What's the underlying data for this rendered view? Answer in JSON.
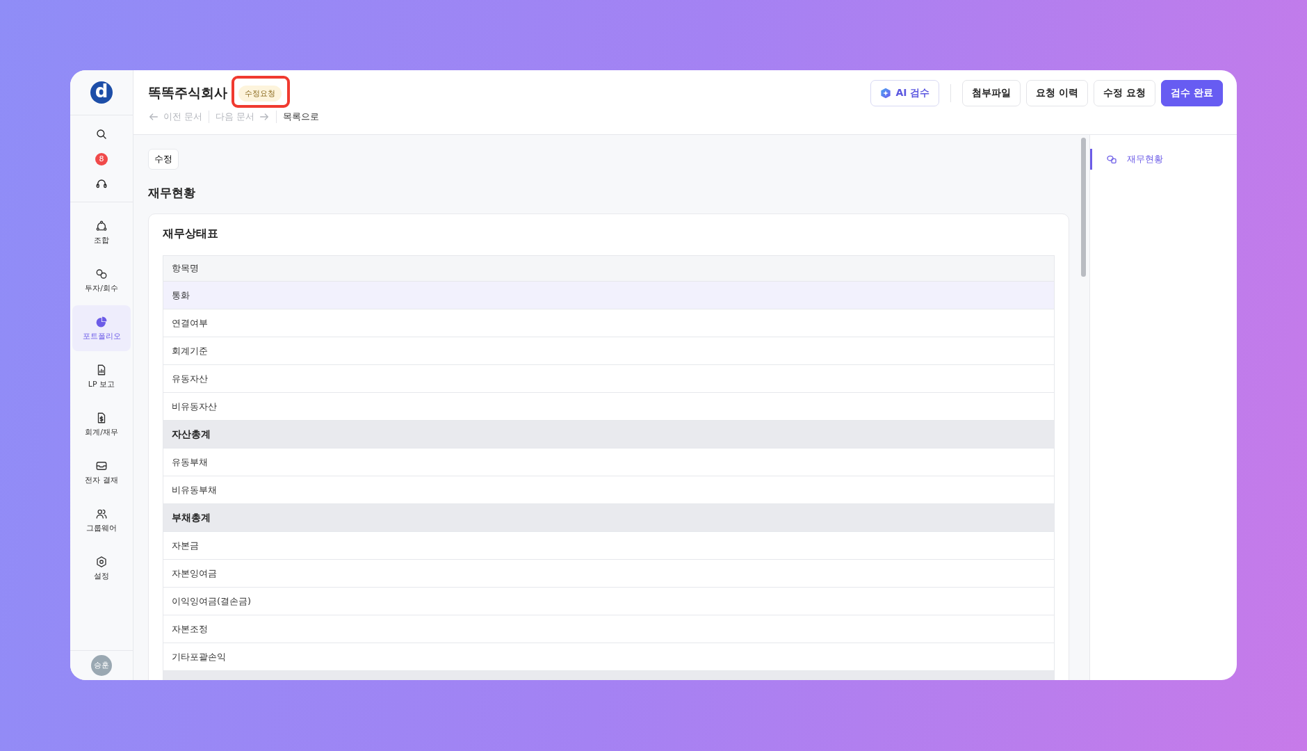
{
  "sidebar": {
    "logo": "d",
    "top_items": [
      {
        "kind": "search"
      },
      {
        "kind": "badge",
        "count": "8"
      },
      {
        "kind": "support"
      }
    ],
    "items": [
      {
        "label": "조합",
        "selected": false
      },
      {
        "label": "투자/회수",
        "selected": false
      },
      {
        "label": "포트폴리오",
        "selected": true
      },
      {
        "label": "LP 보고",
        "selected": false
      },
      {
        "label": "회계/재무",
        "selected": false
      },
      {
        "label": "전자 결재",
        "selected": false
      },
      {
        "label": "그룹웨어",
        "selected": false
      },
      {
        "label": "설정",
        "selected": false
      }
    ],
    "avatar": "승훈"
  },
  "header": {
    "title": "똑똑주식회사",
    "status_badge": {
      "text": "수정요청",
      "highlighted": true
    },
    "nav": [
      {
        "kind": "prev",
        "label": "이전 문서",
        "disabled": true
      },
      {
        "kind": "next",
        "label": "다음 문서",
        "disabled": true
      },
      {
        "kind": "list",
        "label": "목록으로",
        "disabled": false
      }
    ],
    "buttons": [
      {
        "kind": "ai",
        "label": "AI 검수"
      },
      {
        "kind": "plain",
        "label": "첨부파일"
      },
      {
        "kind": "plain",
        "label": "요청 이력"
      },
      {
        "kind": "plain",
        "label": "수정 요청"
      },
      {
        "kind": "primary",
        "label": "검수 완료"
      }
    ]
  },
  "content": {
    "edit_tag": "수정",
    "section_title": "재무현황",
    "card_title": "재무상태표",
    "rows": [
      {
        "label": "항목명",
        "kind": "header"
      },
      {
        "label": "통화",
        "kind": "item",
        "highlighted": true
      },
      {
        "label": "연결여부",
        "kind": "item",
        "highlighted": false
      },
      {
        "label": "회계기준",
        "kind": "item",
        "highlighted": false
      },
      {
        "label": "유동자산",
        "kind": "item",
        "highlighted": false
      },
      {
        "label": "비유동자산",
        "kind": "item",
        "highlighted": false
      },
      {
        "label": "자산총계",
        "kind": "total",
        "highlighted": false
      },
      {
        "label": "유동부채",
        "kind": "item",
        "highlighted": false
      },
      {
        "label": "비유동부채",
        "kind": "item",
        "highlighted": false
      },
      {
        "label": "부채총계",
        "kind": "total",
        "highlighted": false
      },
      {
        "label": "자본금",
        "kind": "item",
        "highlighted": false
      },
      {
        "label": "자본잉여금",
        "kind": "item",
        "highlighted": false
      },
      {
        "label": "이익잉여금(결손금)",
        "kind": "item",
        "highlighted": false
      },
      {
        "label": "자본조정",
        "kind": "item",
        "highlighted": false
      },
      {
        "label": "기타포괄손익",
        "kind": "item",
        "highlighted": false
      },
      {
        "kind": "total",
        "highlighted": false
      }
    ]
  },
  "toc": [
    {
      "label": "재무현황",
      "selected": true
    }
  ]
}
